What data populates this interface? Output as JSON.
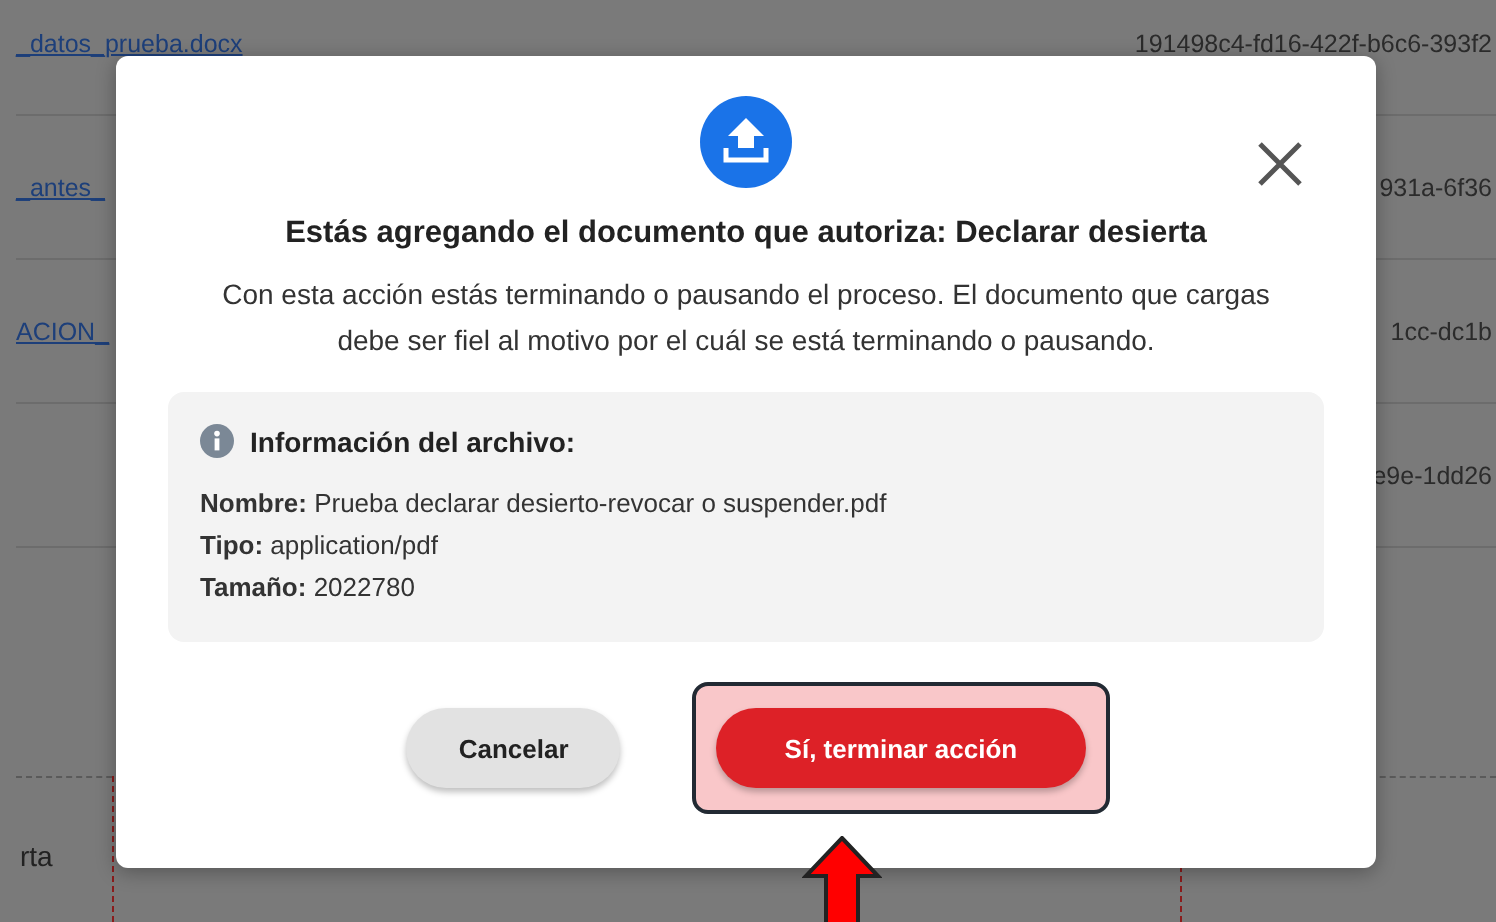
{
  "background_table": {
    "rows": [
      {
        "file": "_datos_prueba.docx",
        "id": "191498c4-fd16-422f-b6c6-393f2"
      },
      {
        "file": "_antes_",
        "id": "931a-6f36"
      },
      {
        "file": "ACION_",
        "id": "1cc-dc1b"
      },
      {
        "id": "e9e-1dd26"
      }
    ]
  },
  "background_label": "rta",
  "dialog": {
    "title": "Estás agregando el documento que autoriza: Declarar desierta",
    "message": "Con esta acción estás terminando o pausando el proceso. El documento que cargas debe ser fiel al motivo por el cuál se está terminando o pausando.",
    "info": {
      "heading": "Información del archivo:",
      "fields": [
        {
          "label": "Nombre:",
          "value": "Prueba declarar desierto-revocar o suspender.pdf"
        },
        {
          "label": "Tipo:",
          "value": "application/pdf"
        },
        {
          "label": "Tamaño:",
          "value": "2022780"
        }
      ]
    },
    "buttons": [
      {
        "label": "Cancelar",
        "kind": "secondary",
        "highlighted": false
      },
      {
        "label": "Sí, terminar acción",
        "kind": "danger",
        "highlighted": true
      }
    ]
  }
}
